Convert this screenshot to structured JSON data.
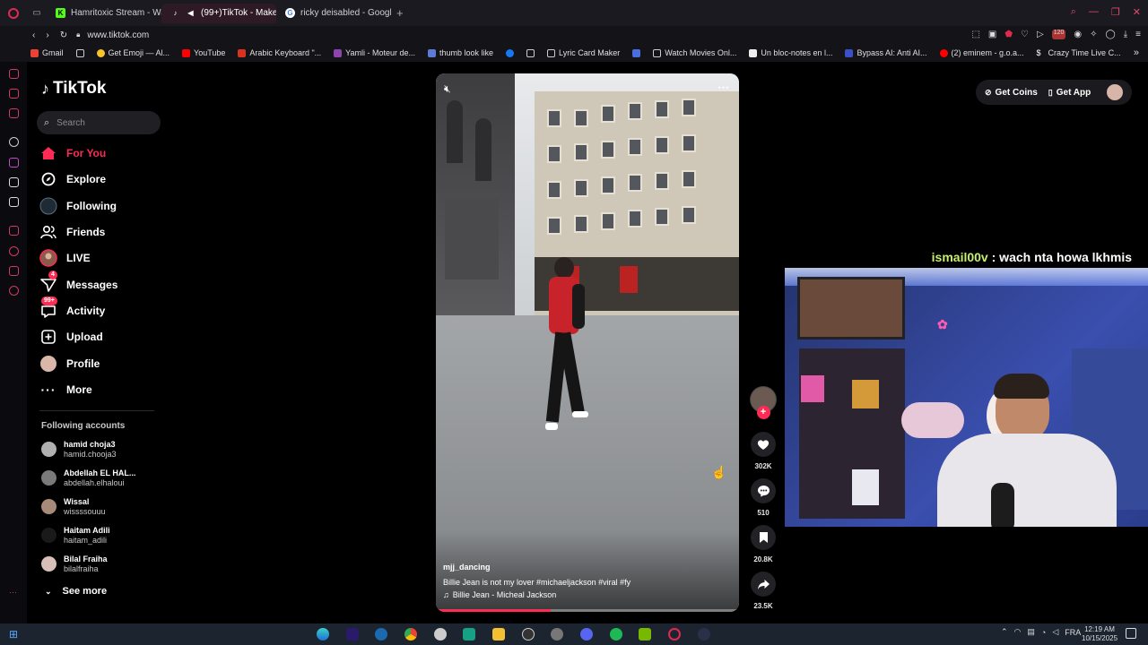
{
  "browser": {
    "tabs": [
      {
        "label": "Hamritoxic Stream - Watc",
        "active": false
      },
      {
        "label": "(99+)TikTok - Make Y",
        "active": true
      },
      {
        "label": "ricky deisabled - Google",
        "active": false
      }
    ],
    "new_tab_label": "+",
    "url": "www.tiktok.com",
    "bookmarks": [
      "Gmail",
      "",
      "Get Emoji — Al...",
      "YouTube",
      "Arabic Keyboard \"...",
      "Yamli - Moteur de...",
      "thumb look like",
      "",
      "",
      "Lyric Card Maker",
      "",
      "Watch Movies Onl...",
      "Un bloc-notes en l...",
      "Bypass AI: Anti AI...",
      "(2) eminem - g.o.a...",
      "Crazy Time Live C..."
    ]
  },
  "tiktok": {
    "logo": "TikTok",
    "search_placeholder": "Search",
    "nav": [
      {
        "label": "For You",
        "icon": "home-icon",
        "active": true
      },
      {
        "label": "Explore",
        "icon": "compass-icon",
        "active": false
      },
      {
        "label": "Following",
        "icon": "following-icon",
        "active": false
      },
      {
        "label": "Friends",
        "icon": "friends-icon",
        "active": false
      },
      {
        "label": "LIVE",
        "icon": "live-icon",
        "active": false
      },
      {
        "label": "Messages",
        "icon": "messages-icon",
        "badge": "4",
        "active": false
      },
      {
        "label": "Activity",
        "icon": "activity-icon",
        "badge": "99+",
        "active": false
      },
      {
        "label": "Upload",
        "icon": "upload-icon",
        "active": false
      },
      {
        "label": "Profile",
        "icon": "profile-icon",
        "active": false
      },
      {
        "label": "More",
        "icon": "more-icon",
        "active": false
      }
    ],
    "following_title": "Following accounts",
    "following": [
      {
        "name": "hamid choja3",
        "handle": "hamid.chooja3"
      },
      {
        "name": "Abdellah EL HAL...",
        "handle": "abdellah.elhaloui"
      },
      {
        "name": "Wissal",
        "handle": "wissssouuu"
      },
      {
        "name": "Haitam Adili",
        "handle": "haitam_adili"
      },
      {
        "name": "Bilal Fraiha",
        "handle": "bilalfraiha"
      }
    ],
    "see_more": "See more",
    "top_right": {
      "coins": "Get Coins",
      "app": "Get App"
    },
    "video": {
      "username": "mjj_dancing",
      "caption": "Billie Jean is not my lover #michaeljackson #viral #fy",
      "music": "Billie Jean - Micheal Jackson",
      "progress": 0.38
    },
    "actions": {
      "likes": "302K",
      "comments": "510",
      "saves": "20.8K",
      "shares": "23.5K"
    }
  },
  "stream": {
    "chat_user": "ismail00v",
    "chat_message": " : wach nta howa lkhmis"
  },
  "taskbar": {
    "lang": "FRA",
    "time": "12:19 AM",
    "date": "10/15/2025"
  }
}
